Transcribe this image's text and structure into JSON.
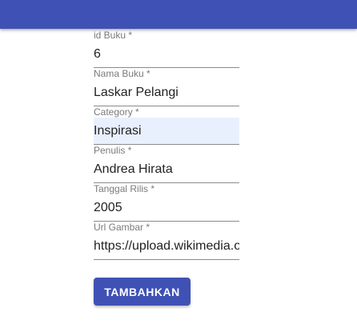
{
  "form": {
    "fields": [
      {
        "label": "id Buku *",
        "value": "6"
      },
      {
        "label": "Nama Buku *",
        "value": "Laskar Pelangi"
      },
      {
        "label": "Category *",
        "value": "Inspirasi"
      },
      {
        "label": "Penulis *",
        "value": "Andrea Hirata"
      },
      {
        "label": "Tanggal Rilis *",
        "value": "2005"
      },
      {
        "label": "Url Gambar *",
        "value": "https://upload.wikimedia.org"
      }
    ],
    "submit_label": "TAMBAHKAN"
  },
  "colors": {
    "primary": "#3f51b5",
    "autofill_bg": "#e8f0fe"
  }
}
